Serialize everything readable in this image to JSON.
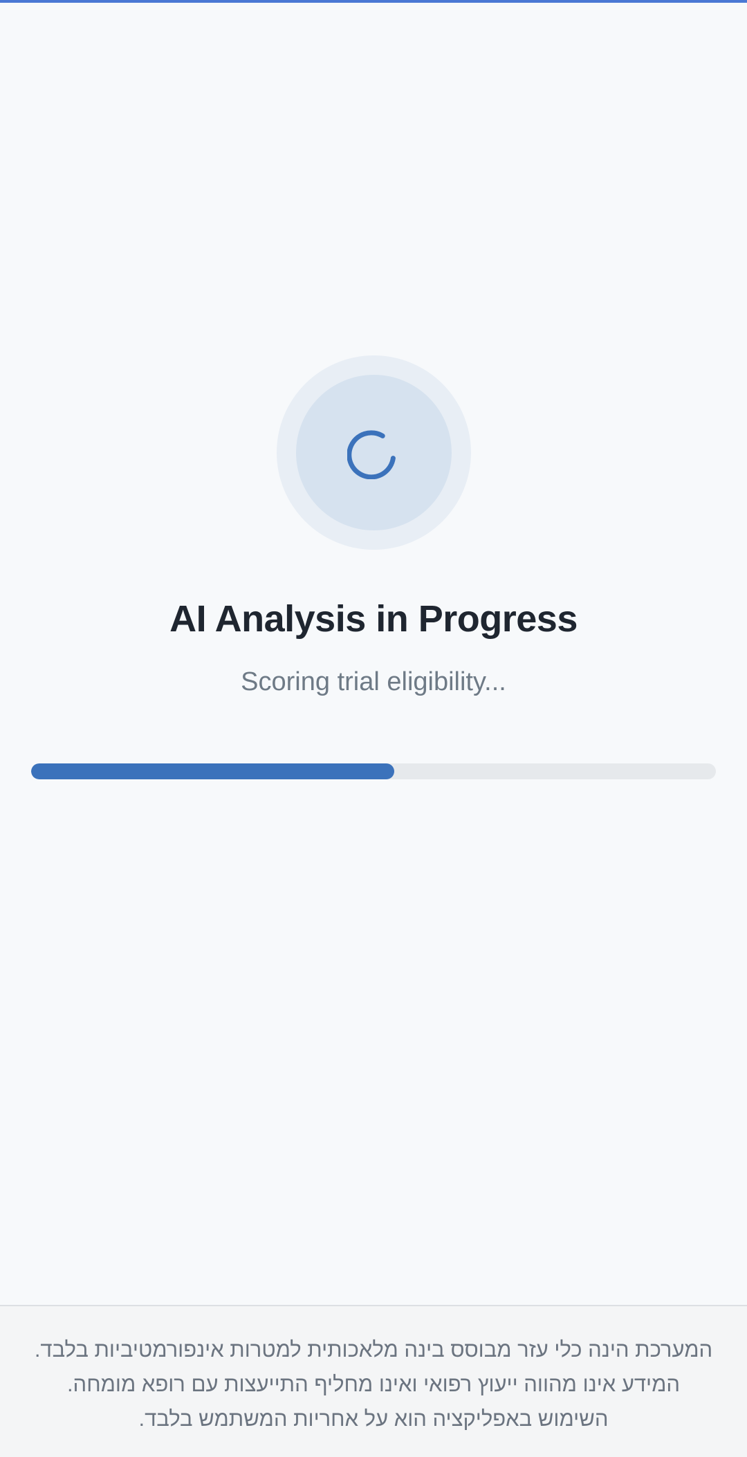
{
  "colors": {
    "accent": "#3b72bb",
    "top_bar": "#4a78d4",
    "background": "#f7f9fb",
    "title": "#1f2630",
    "subtitle": "#6e7a86"
  },
  "loader": {
    "icon": "spinner-icon"
  },
  "status": {
    "title": "AI Analysis in Progress",
    "subtitle": "Scoring trial eligibility..."
  },
  "progress": {
    "fraction": 0.53
  },
  "footer": {
    "disclaimer": "המערכת הינה כלי עזר מבוסס בינה מלאכותית למטרות אינפורמטיביות בלבד. המידע אינו מהווה ייעוץ רפואי ואינו מחליף התייעצות עם רופא מומחה. השימוש באפליקציה הוא על אחריות המשתמש בלבד."
  }
}
